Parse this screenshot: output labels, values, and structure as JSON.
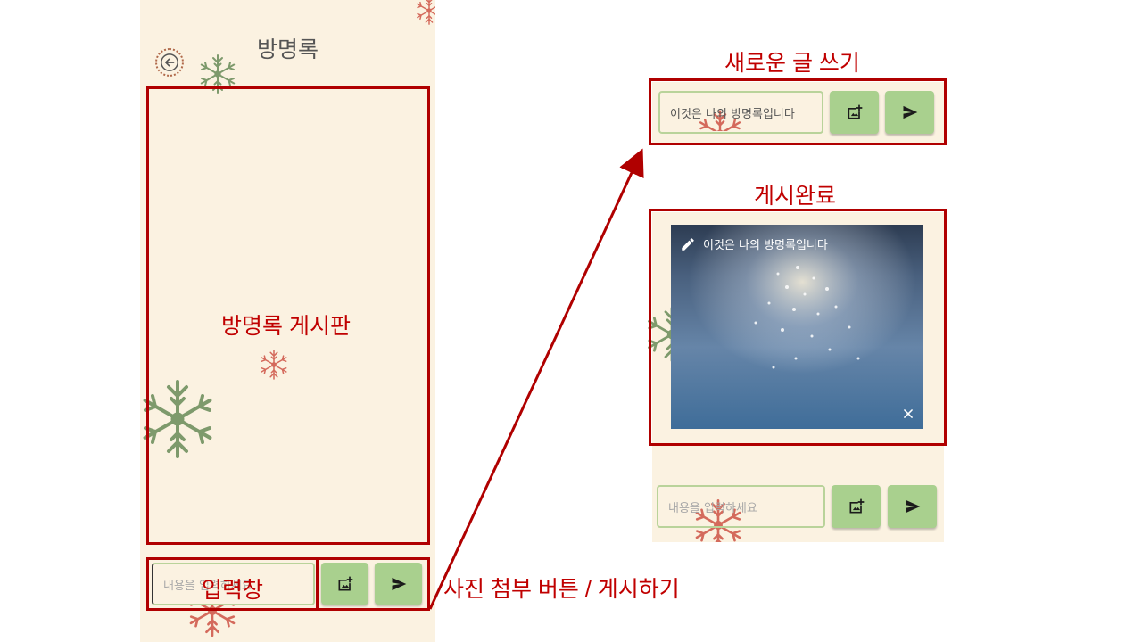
{
  "app": {
    "title": "방명록"
  },
  "composer": {
    "placeholder": "내용을 입력하세요",
    "typed_text": "이것은 나의 방명록입니다"
  },
  "post": {
    "caption": "이것은 나의 방명록입니다"
  },
  "annotations": {
    "board": "방명록 게시판",
    "input": "입력창",
    "buttons": "사진 첨부 버튼 / 게시하기",
    "new_post": "새로운 글 쓰기",
    "posted": "게시완료"
  },
  "icons": [
    "back-arrow-icon",
    "add-photo-icon",
    "send-icon",
    "pencil-icon",
    "close-icon",
    "snowflake-icon"
  ],
  "colors": {
    "background": "#fbf2e1",
    "button": "#a9d08e",
    "input_border": "#b9d39a",
    "annotation": "#c00000",
    "snowflake_green": "#7e9a6c",
    "snowflake_red": "#d46a5c"
  }
}
